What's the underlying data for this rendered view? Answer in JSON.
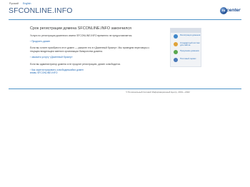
{
  "header": {
    "langs": [
      "Русский",
      "English"
    ],
    "site_title": "SFCONLINE.INFO",
    "logo_text": "center",
    "logo_mark": "ru"
  },
  "main": {
    "heading": "Срок регистрации домена SFCONLINE.INFO закончился",
    "p1": "Услуга по регистрации доменного имени SFCONLINE.INFO временно не предоставляется.",
    "link_renew": "› Продлить домен",
    "p2": "Если вы хотите приобрести этот домен — укажите его в «Доменный брокер». Мы проведем переговоры с текущим владельцем имени в организации банкротства домена.",
    "link_broker": "› заказать услугу «Доменный брокер»",
    "p3": "Если вы администратор домена и не продлит регистрацию, домен освободится.",
    "link_admin": "› Как зарегистрировать освободившийся домен",
    "link_admin2": "  вновь SFCONLINE.INFO"
  },
  "sidebar": {
    "items": [
      {
        "label": "Регистрация доменов",
        "icon": "globe-icon",
        "color": "#3f86c9"
      },
      {
        "label": "Стандартный хостинг для сайтов",
        "icon": "server-icon",
        "color": "#e0a23a"
      },
      {
        "label": "Продление доменов",
        "icon": "refresh-icon",
        "color": "#5aa84e"
      },
      {
        "label": "Почтовый сервис",
        "icon": "mail-icon",
        "color": "#4b79b8"
      }
    ]
  },
  "footer": {
    "text": "© Региональный Сетевой Информационный Центр, 2001—2022"
  }
}
